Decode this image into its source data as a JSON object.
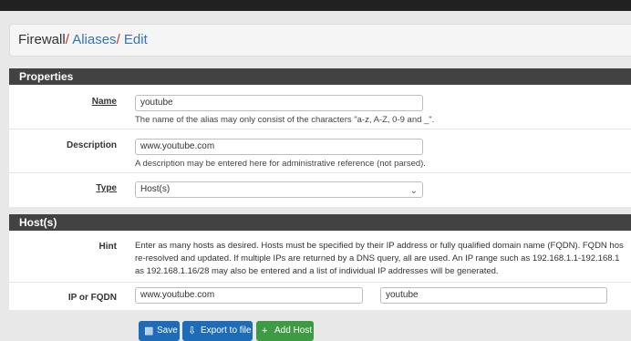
{
  "breadcrumb": {
    "root": "Firewall",
    "separator": "/",
    "aliases": "Aliases",
    "edit": "Edit"
  },
  "properties": {
    "heading": "Properties",
    "name": {
      "label": "Name",
      "value": "youtube",
      "help": "The name of the alias may only consist of the characters \"a-z, A-Z, 0-9 and _\"."
    },
    "description": {
      "label": "Description",
      "value": "www.youtube.com",
      "help": "A description may be entered here for administrative reference (not parsed)."
    },
    "type": {
      "label": "Type",
      "value": "Host(s)"
    }
  },
  "hosts": {
    "heading": "Host(s)",
    "hint_label": "Hint",
    "hint_lines": [
      "Enter as many hosts as desired. Hosts must be specified by their IP address or fully qualified domain name (FQDN). FQDN hos",
      "re-resolved and updated. If multiple IPs are returned by a DNS query, all are used. An IP range such as 192.168.1.1-192.168.1",
      "as 192.168.1.16/28 may also be entered and a list of individual IP addresses will be generated."
    ],
    "ip_label": "IP or FQDN",
    "ip_value": "www.youtube.com",
    "ip_description": "youtube"
  },
  "buttons": {
    "save": "Save",
    "export": "Export to file",
    "add_host": "Add Host"
  },
  "colors": {
    "accent_blue": "#3872b5",
    "separator_red": "#c9302c",
    "panel_header": "#424242",
    "button_green": "#3e9a43"
  }
}
